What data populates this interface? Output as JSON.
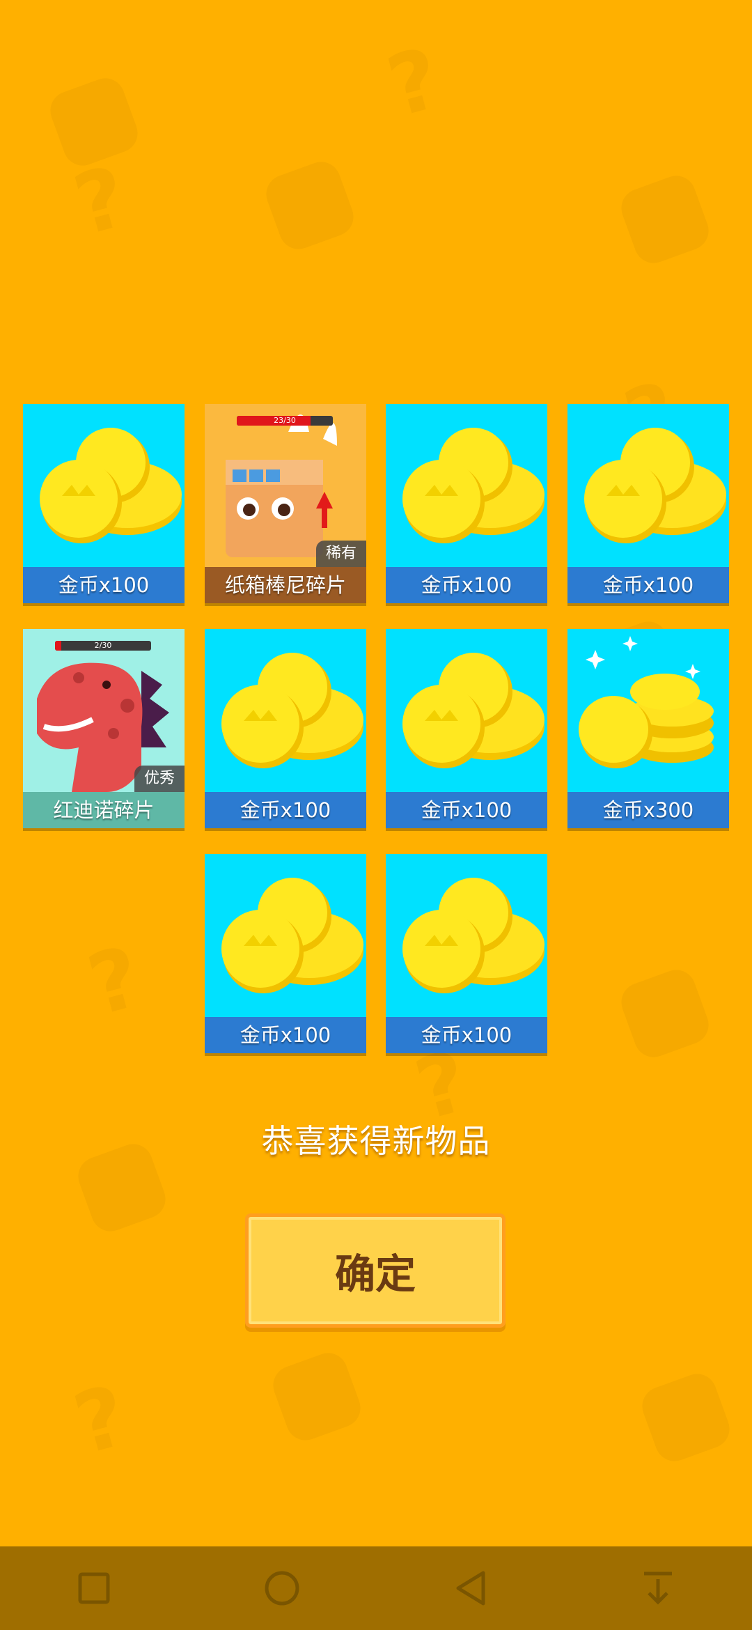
{
  "colors": {
    "background": "#FFB000",
    "card_blue": "#00E1FF",
    "label_blue": "#2C7BD1",
    "card_orange": "#FBB93F",
    "card_mint": "#9FF0E6",
    "button_fill": "#FFD24A",
    "button_border": "#FF9E1F",
    "navbar": "#9F6E00"
  },
  "rewards": {
    "items": [
      {
        "label": "金币x100",
        "type": "coin"
      },
      {
        "label": "纸箱棒尼碎片",
        "type": "fragment",
        "progress_text": "23/30",
        "progress": 0.767,
        "rarity": "稀有"
      },
      {
        "label": "金币x100",
        "type": "coin"
      },
      {
        "label": "金币x100",
        "type": "coin"
      },
      {
        "label": "红迪诺碎片",
        "type": "fragment",
        "progress_text": "2/30",
        "progress": 0.067,
        "rarity": "优秀"
      },
      {
        "label": "金币x100",
        "type": "coin"
      },
      {
        "label": "金币x100",
        "type": "coin"
      },
      {
        "label": "金币x300",
        "type": "coin-pile"
      },
      {
        "label": "金币x100",
        "type": "coin"
      },
      {
        "label": "金币x100",
        "type": "coin"
      }
    ]
  },
  "message": "恭喜获得新物品",
  "confirm_button": {
    "label": "确定"
  },
  "navbar": {
    "icons": [
      "square-recent-apps-icon",
      "circle-home-icon",
      "triangle-back-icon",
      "notification-pull-down-icon"
    ]
  }
}
